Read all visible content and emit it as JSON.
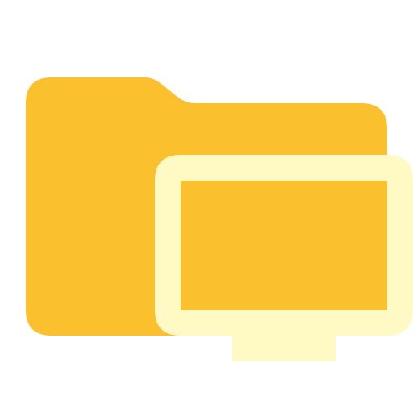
{
  "icon": {
    "name": "folder-desktop-icon",
    "colors": {
      "folder": "#FBC02D",
      "monitor": "#FFF9C4",
      "screen": "#FBC02D"
    }
  }
}
